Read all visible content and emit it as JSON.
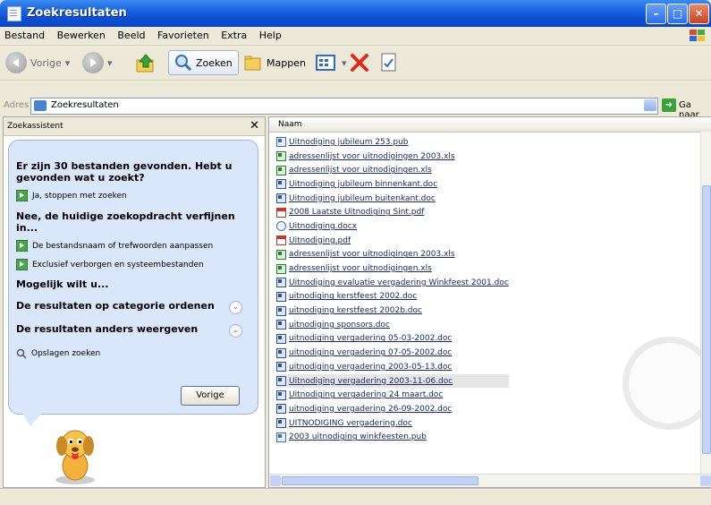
{
  "window": {
    "title": "Zoekresultaten"
  },
  "menu": [
    "Bestand",
    "Bewerken",
    "Beeld",
    "Favorieten",
    "Extra",
    "Help"
  ],
  "toolbar": {
    "back": "Vorige",
    "search": "Zoeken",
    "folders": "Mappen"
  },
  "address": {
    "label": "Adres",
    "value": "Zoekresultaten",
    "go": "Ga naar"
  },
  "left_pane": {
    "title": "Zoekassistent",
    "question": "Er zijn 30 bestanden gevonden. Hebt u gevonden wat u zoekt?",
    "option_stop": "Ja, stoppen met zoeken",
    "refine_heading": "Nee, de huidige zoekopdracht verfijnen in...",
    "option_names": "De bestandsnaam of trefwoorden aanpassen",
    "option_hidden": "Exclusief verborgen en systeembestanden",
    "maybe_heading": "Mogelijk wilt u...",
    "sort_by_category": "De resultaten op categorie ordenen",
    "display_other": "De resultaten anders weergeven",
    "save_search": "Opslagen zoeken",
    "back_button": "Vorige"
  },
  "file_list": {
    "column_name": "Naam",
    "files": [
      {
        "name": "Uitnodiging jubileum 253.pub",
        "type": "pub"
      },
      {
        "name": "adressenlijst voor uitnodigingen 2003.xls",
        "type": "xls"
      },
      {
        "name": "adressenlijst voor uitnodigingen.xls",
        "type": "xls"
      },
      {
        "name": "Uitnodiging jubileum binnenkant.doc",
        "type": "doc"
      },
      {
        "name": "Uitnodiging jubileum buitenkant.doc",
        "type": "doc"
      },
      {
        "name": "2008 Laatste Uitnodiging Sint.pdf",
        "type": "pdf"
      },
      {
        "name": "Uitnodiging.docx",
        "type": "docx"
      },
      {
        "name": "Uitnodiging.pdf",
        "type": "pdf"
      },
      {
        "name": "adressenlijst voor uitnodigingen 2003.xls",
        "type": "xls"
      },
      {
        "name": "adressenlijst voor uitnodigingen.xls",
        "type": "xls"
      },
      {
        "name": "Uitnodiging evaluatie vergadering Winkfeest 2001.doc",
        "type": "doc"
      },
      {
        "name": "uitnodiging kerstfeest 2002.doc",
        "type": "doc"
      },
      {
        "name": "uitnodiging kerstfeest 2002b.doc",
        "type": "doc"
      },
      {
        "name": "uitnodiging sponsors.doc",
        "type": "doc"
      },
      {
        "name": "uitnodiging vergadering 05-03-2002.doc",
        "type": "doc"
      },
      {
        "name": "uitnodiging vergadering 07-05-2002.doc",
        "type": "doc"
      },
      {
        "name": "uitnodiging vergadering 2003-05-13.doc",
        "type": "doc"
      },
      {
        "name": "Uitnodiging vergadering 2003-11-06.doc",
        "type": "doc",
        "selected": true
      },
      {
        "name": "Uitnodiging vergadering 24 maart.doc",
        "type": "doc"
      },
      {
        "name": "uitnodiging vergadering 26-09-2002.doc",
        "type": "doc"
      },
      {
        "name": "UITNODIGING vergadering.doc",
        "type": "doc"
      },
      {
        "name": "2003 uitnodiging winkfeesten.pub",
        "type": "pub"
      }
    ]
  },
  "colors": {
    "title_bar": "#0a4fd3",
    "task_pane": "#dae6f9",
    "link": "#1a2a6c"
  }
}
